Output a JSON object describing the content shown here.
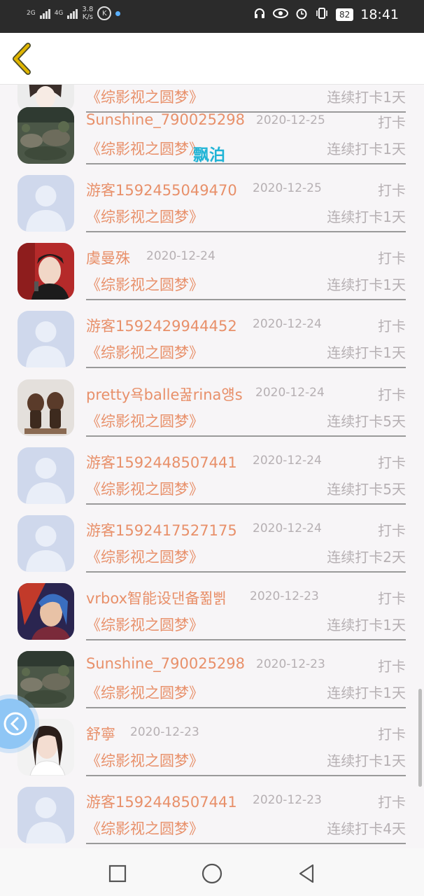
{
  "status_bar": {
    "net_type_1": "2G",
    "net_type_2": "4G",
    "net_speed": "3.8",
    "net_unit": "K/s",
    "k_badge": "K",
    "battery": "82",
    "time": "18:41",
    "icons": [
      "headphones-icon",
      "eye-icon",
      "alarm-icon",
      "vibrate-icon"
    ]
  },
  "header": {
    "back_icon": "chevron-left-icon",
    "accent": "#e0b500"
  },
  "watermark": "飘泊",
  "entries": [
    {
      "name": "",
      "date": "",
      "book": "《综影视之圆梦》",
      "streak": "连续打卡1天",
      "checkin": "",
      "avatar": "photo-girl"
    },
    {
      "name": "Sunshine_790025298",
      "date": "2020-12-25",
      "book": "《综影视之圆梦》",
      "streak": "连续打卡1天",
      "checkin": "打卡",
      "avatar": "photo-rocks"
    },
    {
      "name": "游客1592455049470",
      "date": "2020-12-25",
      "book": "《综影视之圆梦》",
      "streak": "连续打卡1天",
      "checkin": "打卡",
      "avatar": "default"
    },
    {
      "name": "虞曼殊",
      "date": "2020-12-24",
      "book": "《综影视之圆梦》",
      "streak": "连续打卡1天",
      "checkin": "打卡",
      "avatar": "photo-singer"
    },
    {
      "name": "游客1592429944452",
      "date": "2020-12-24",
      "book": "《综影视之圆梦》",
      "streak": "连续打卡1天",
      "checkin": "打卡",
      "avatar": "default"
    },
    {
      "name": "pretty욕balle꿆rina얭s",
      "date": "2020-12-24",
      "book": "《综影视之圆梦》",
      "streak": "连续打卡5天",
      "checkin": "打卡",
      "avatar": "photo-figurines"
    },
    {
      "name": "游客1592448507441",
      "date": "2020-12-24",
      "book": "《综影视之圆梦》",
      "streak": "连续打卡5天",
      "checkin": "打卡",
      "avatar": "default"
    },
    {
      "name": "游客1592417527175",
      "date": "2020-12-24",
      "book": "《综影视之圆梦》",
      "streak": "连续打卡2天",
      "checkin": "打卡",
      "avatar": "default"
    },
    {
      "name": "vrbox智能设댄备쮦삙",
      "date": "2020-12-23",
      "book": "《综影视之圆梦》",
      "streak": "连续打卡1天",
      "checkin": "打卡",
      "avatar": "photo-game"
    },
    {
      "name": "Sunshine_790025298",
      "date": "2020-12-23",
      "book": "《综影视之圆梦》",
      "streak": "连续打卡1天",
      "checkin": "打卡",
      "avatar": "photo-rocks"
    },
    {
      "name": "舒寧",
      "date": "2020-12-23",
      "book": "《综影视之圆梦》",
      "streak": "连续打卡1天",
      "checkin": "打卡",
      "avatar": "photo-woman"
    },
    {
      "name": "游客1592448507441",
      "date": "2020-12-23",
      "book": "《综影视之圆梦》",
      "streak": "连续打卡4天",
      "checkin": "打卡",
      "avatar": "default"
    }
  ],
  "colors": {
    "name": "#e8906a",
    "meta": "#b6b0b3",
    "background": "#f7f5f7"
  },
  "nav_bar": [
    "recents-square-icon",
    "home-circle-icon",
    "back-triangle-icon"
  ]
}
